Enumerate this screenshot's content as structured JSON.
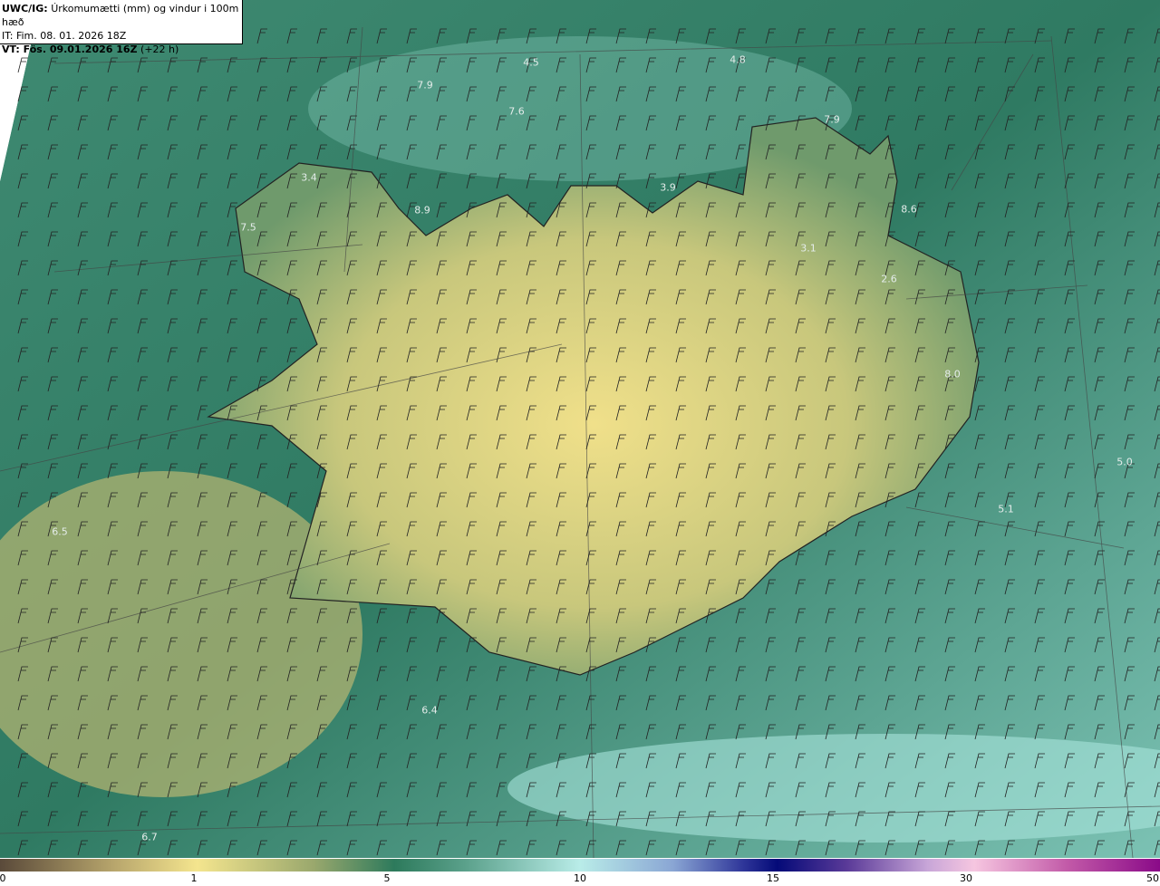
{
  "header": {
    "model_label": "UWC/IG:",
    "title": "Úrkomumætti (mm) og vindur i 100m hæð",
    "initial_time": "IT: Fim. 08. 01. 2026 18Z",
    "valid_label": "VT: Fös. 09.01.2026 16Z",
    "lead": "(+22 h)"
  },
  "colorbar": {
    "ticks": [
      "0",
      "1",
      "5",
      "10",
      "15",
      "30",
      "50"
    ]
  },
  "value_labels": [
    "4.5",
    "4.8",
    "7.9",
    "7.6",
    "7.9",
    "3.4",
    "8.9",
    "7.5",
    "3.9",
    "3.1",
    "2.6",
    "8.6",
    "8.0",
    "5.0",
    "5.1",
    "6.5",
    "6.4",
    "6.7"
  ],
  "colors": {
    "low": "#f0e08a",
    "mid": "#2e7a60",
    "high": "#bfeee9"
  }
}
